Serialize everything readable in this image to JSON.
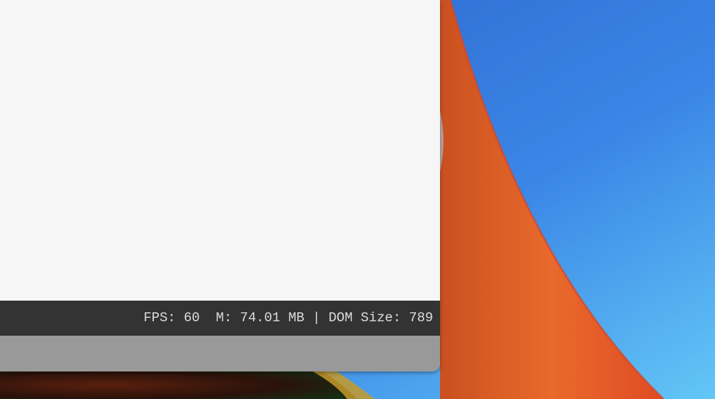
{
  "status_bar": {
    "fps_label": "FPS:",
    "fps_value": "60",
    "memory_label": "M:",
    "memory_value": "74.01 MB",
    "separator": "|",
    "dom_label": "DOM Size:",
    "dom_value": "789"
  },
  "colors": {
    "window_background": "#f6f6f6",
    "status_bar": "#333333",
    "status_text": "#dcdcdc",
    "bottom_panel": "#999999",
    "wallpaper_blue": "#347fe0",
    "wallpaper_orange": "#e8672c"
  }
}
